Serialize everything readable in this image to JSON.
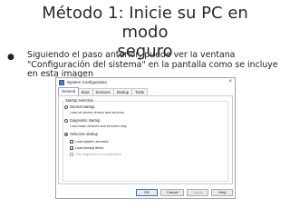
{
  "slide": {
    "title_line1": "Método 1: Inicie su PC en modo",
    "title_line2": "seguro",
    "bullet": "Siguiendo el paso anterior, puede ver la ventana \"Configuración del sistema\" en la pantalla como se incluye en esta imagen"
  },
  "dialog": {
    "title": "System Configuration",
    "close_label": "×",
    "tabs": [
      "General",
      "Boot",
      "Services",
      "Startup",
      "Tools"
    ],
    "group_label": "Startup selection",
    "options": [
      {
        "label": "Normal startup",
        "desc": "Load all device drivers and services",
        "selected": false
      },
      {
        "label": "Diagnostic startup",
        "desc": "Load basic devices and services only",
        "selected": false
      },
      {
        "label": "Selective startup",
        "selected": true
      }
    ],
    "checks": [
      {
        "label": "Load system services",
        "checked": true,
        "disabled": false
      },
      {
        "label": "Load startup items",
        "checked": true,
        "disabled": false
      },
      {
        "label": "Use original boot configuration",
        "checked": true,
        "disabled": true
      }
    ],
    "buttons": {
      "ok": "OK",
      "cancel": "Cancel",
      "apply": "Apply",
      "help": "Help"
    }
  },
  "colors": {
    "accent": "#2f6fcc",
    "title_text": "#2a2a2a"
  },
  "icons": {
    "app": "system-config-icon",
    "close": "close-icon"
  }
}
